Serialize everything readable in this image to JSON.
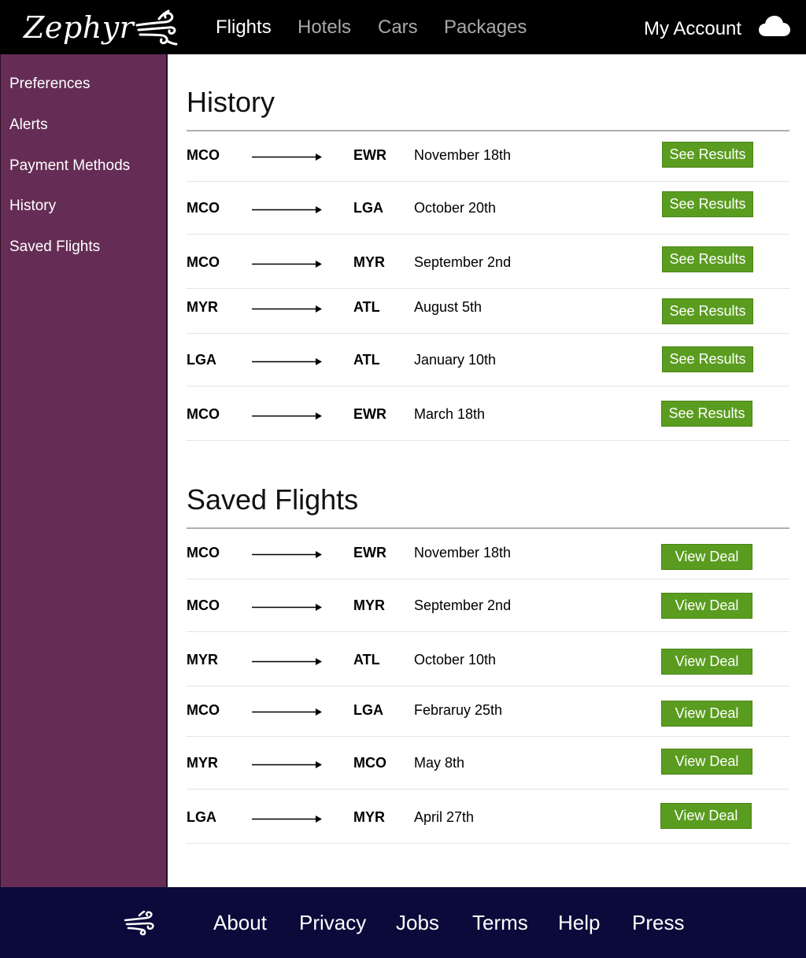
{
  "brand": {
    "name": "Zephyr"
  },
  "nav": {
    "flights": "Flights",
    "hotels": "Hotels",
    "cars": "Cars",
    "packages": "Packages"
  },
  "account": {
    "label": "My Account"
  },
  "sidebar": {
    "items": [
      {
        "label": "Preferences"
      },
      {
        "label": "Alerts"
      },
      {
        "label": "Payment Methods"
      },
      {
        "label": "History"
      },
      {
        "label": "Saved Flights"
      }
    ]
  },
  "history": {
    "title": "History",
    "button_label": "See Results",
    "rows": [
      {
        "from": "MCO",
        "to": "EWR",
        "date": "November 18th"
      },
      {
        "from": "MCO",
        "to": "LGA",
        "date": "October 20th"
      },
      {
        "from": "MCO",
        "to": "MYR",
        "date": "September 2nd"
      },
      {
        "from": "MYR",
        "to": "ATL",
        "date": "August 5th"
      },
      {
        "from": "LGA",
        "to": "ATL",
        "date": "January 10th"
      },
      {
        "from": "MCO",
        "to": "EWR",
        "date": "March 18th"
      }
    ]
  },
  "saved": {
    "title": "Saved Flights",
    "button_label": "View Deal",
    "rows": [
      {
        "from": "MCO",
        "to": "EWR",
        "date": "November 18th"
      },
      {
        "from": "MCO",
        "to": "MYR",
        "date": "September 2nd"
      },
      {
        "from": "MYR",
        "to": "ATL",
        "date": "October 10th"
      },
      {
        "from": "MCO",
        "to": "LGA",
        "date": "Febraruy 25th"
      },
      {
        "from": "MYR",
        "to": "MCO",
        "date": "May 8th"
      },
      {
        "from": "LGA",
        "to": "MYR",
        "date": "April 27th"
      }
    ]
  },
  "footer": {
    "links": [
      {
        "label": "About"
      },
      {
        "label": "Privacy"
      },
      {
        "label": "Jobs"
      },
      {
        "label": "Terms"
      },
      {
        "label": "Help"
      },
      {
        "label": "Press"
      }
    ]
  },
  "colors": {
    "header": "#000000",
    "sidebar": "#652d56",
    "button": "#5a9c1f",
    "footer": "#0b0a3a"
  },
  "icons": {
    "logo": "wind-icon",
    "account": "cloud-icon",
    "footer": "wind-icon"
  }
}
